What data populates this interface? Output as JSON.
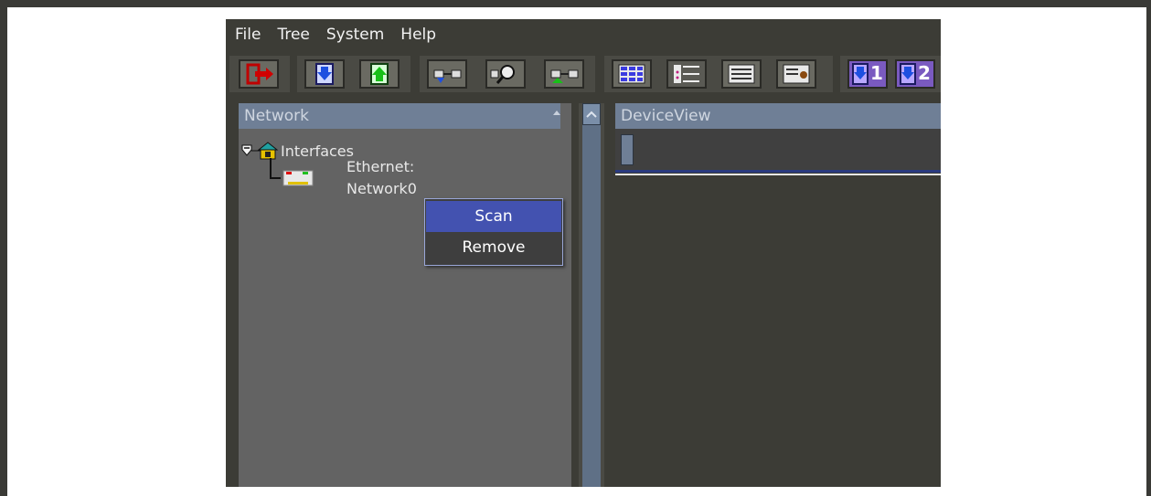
{
  "menu": {
    "items": [
      "File",
      "Tree",
      "System",
      "Help"
    ]
  },
  "toolbar": {
    "icons": [
      "exit-icon",
      "download-icon",
      "upload-icon",
      "network-down-icon",
      "scan-magnifier-icon",
      "network-up-icon",
      "grid-view-icon",
      "tree-view-icon",
      "list-view-icon",
      "device-detail-icon",
      "download-1-icon",
      "download-2-icon"
    ],
    "badge_1": "1",
    "badge_2": "2"
  },
  "network_panel": {
    "title": "Network",
    "tree": {
      "root_label": "Interfaces",
      "child_line1": "Ethernet:",
      "child_line2": "Network0"
    }
  },
  "device_panel": {
    "title": "DeviceView"
  },
  "context_menu": {
    "items": [
      "Scan",
      "Remove"
    ],
    "active_index": 0
  },
  "colors": {
    "app_bg": "#3c3c36",
    "panel_header": "#6f7f96",
    "menu_highlight": "#4352b0"
  }
}
